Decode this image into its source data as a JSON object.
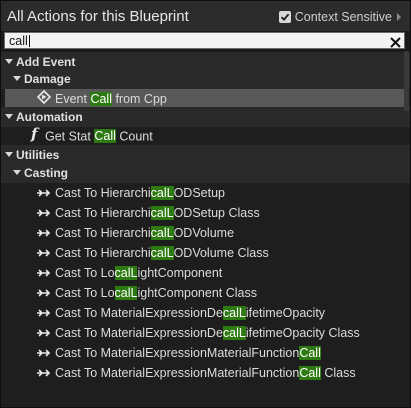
{
  "header": {
    "title": "All Actions for this Blueprint",
    "context_sensitive_label": "Context Sensitive"
  },
  "search": {
    "value": "call"
  },
  "tree": {
    "add_event": "Add Event",
    "damage": "Damage",
    "event_call": {
      "pre": "Event ",
      "hl": "Call",
      "post": " from Cpp"
    },
    "automation": "Automation",
    "get_stat": {
      "pre": "Get Stat ",
      "hl": "Call",
      "post": " Count"
    },
    "utilities": "Utilities",
    "casting": "Casting",
    "casts": [
      {
        "pre": "Cast To Hierarchi",
        "hl": "calL",
        "post": "ODSetup"
      },
      {
        "pre": "Cast To Hierarchi",
        "hl": "calL",
        "post": "ODSetup Class"
      },
      {
        "pre": "Cast To Hierarchi",
        "hl": "calL",
        "post": "ODVolume"
      },
      {
        "pre": "Cast To Hierarchi",
        "hl": "calL",
        "post": "ODVolume Class"
      },
      {
        "pre": "Cast To Lo",
        "hl": "calL",
        "post": "ightComponent"
      },
      {
        "pre": "Cast To Lo",
        "hl": "calL",
        "post": "ightComponent Class"
      },
      {
        "pre": "Cast To MaterialExpressionDe",
        "hl": "calL",
        "post": "ifetimeOpacity"
      },
      {
        "pre": "Cast To MaterialExpressionDe",
        "hl": "calL",
        "post": "ifetimeOpacity Class"
      },
      {
        "pre": "Cast To MaterialExpressionMaterialFunction",
        "hl": "Call",
        "post": ""
      },
      {
        "pre": "Cast To MaterialExpressionMaterialFunction",
        "hl": "Call",
        "post": " Class"
      }
    ]
  },
  "colors": {
    "highlight": "#2e7a12",
    "selected_row": "#585858",
    "background": "#1e1e1e"
  },
  "icons": {
    "event": "event-diamond-icon",
    "function": "function-f-icon",
    "cast": "cast-arrow-icon",
    "checkbox": "checkbox-checked-icon",
    "clear": "clear-x-icon"
  }
}
